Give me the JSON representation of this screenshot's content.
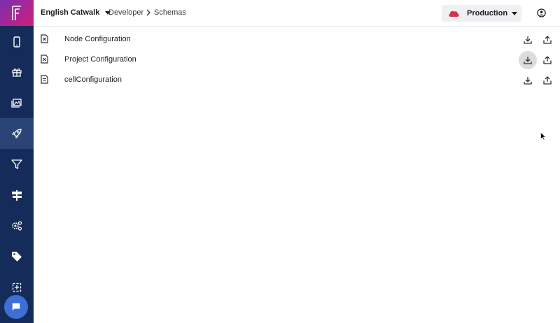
{
  "header": {
    "project_name": "English Catwalk",
    "breadcrumb": [
      "Developer",
      "Schemas"
    ],
    "environment": "Production"
  },
  "schemas": [
    {
      "name": "Node Configuration",
      "icon": "file-x-icon"
    },
    {
      "name": "Project Configuration",
      "icon": "file-x-icon"
    },
    {
      "name": "cellConfiguration",
      "icon": "file-check-icon"
    }
  ],
  "sidebar": {
    "items": [
      "phone-icon",
      "gift-icon",
      "image-gallery-icon",
      "rocket-icon",
      "filter-icon",
      "signpost-icon",
      "gears-icon",
      "tag-icon",
      "crosshair-icon"
    ],
    "active": "rocket-icon"
  },
  "colors": {
    "sidebar_bg": "#152c5b",
    "sidebar_active": "#2a4575",
    "logo_gradient_start": "#7a2fb0",
    "logo_gradient_end": "#d01f7a",
    "environment_cloud": "#d6334a",
    "chat_button": "#3e6fd6"
  }
}
